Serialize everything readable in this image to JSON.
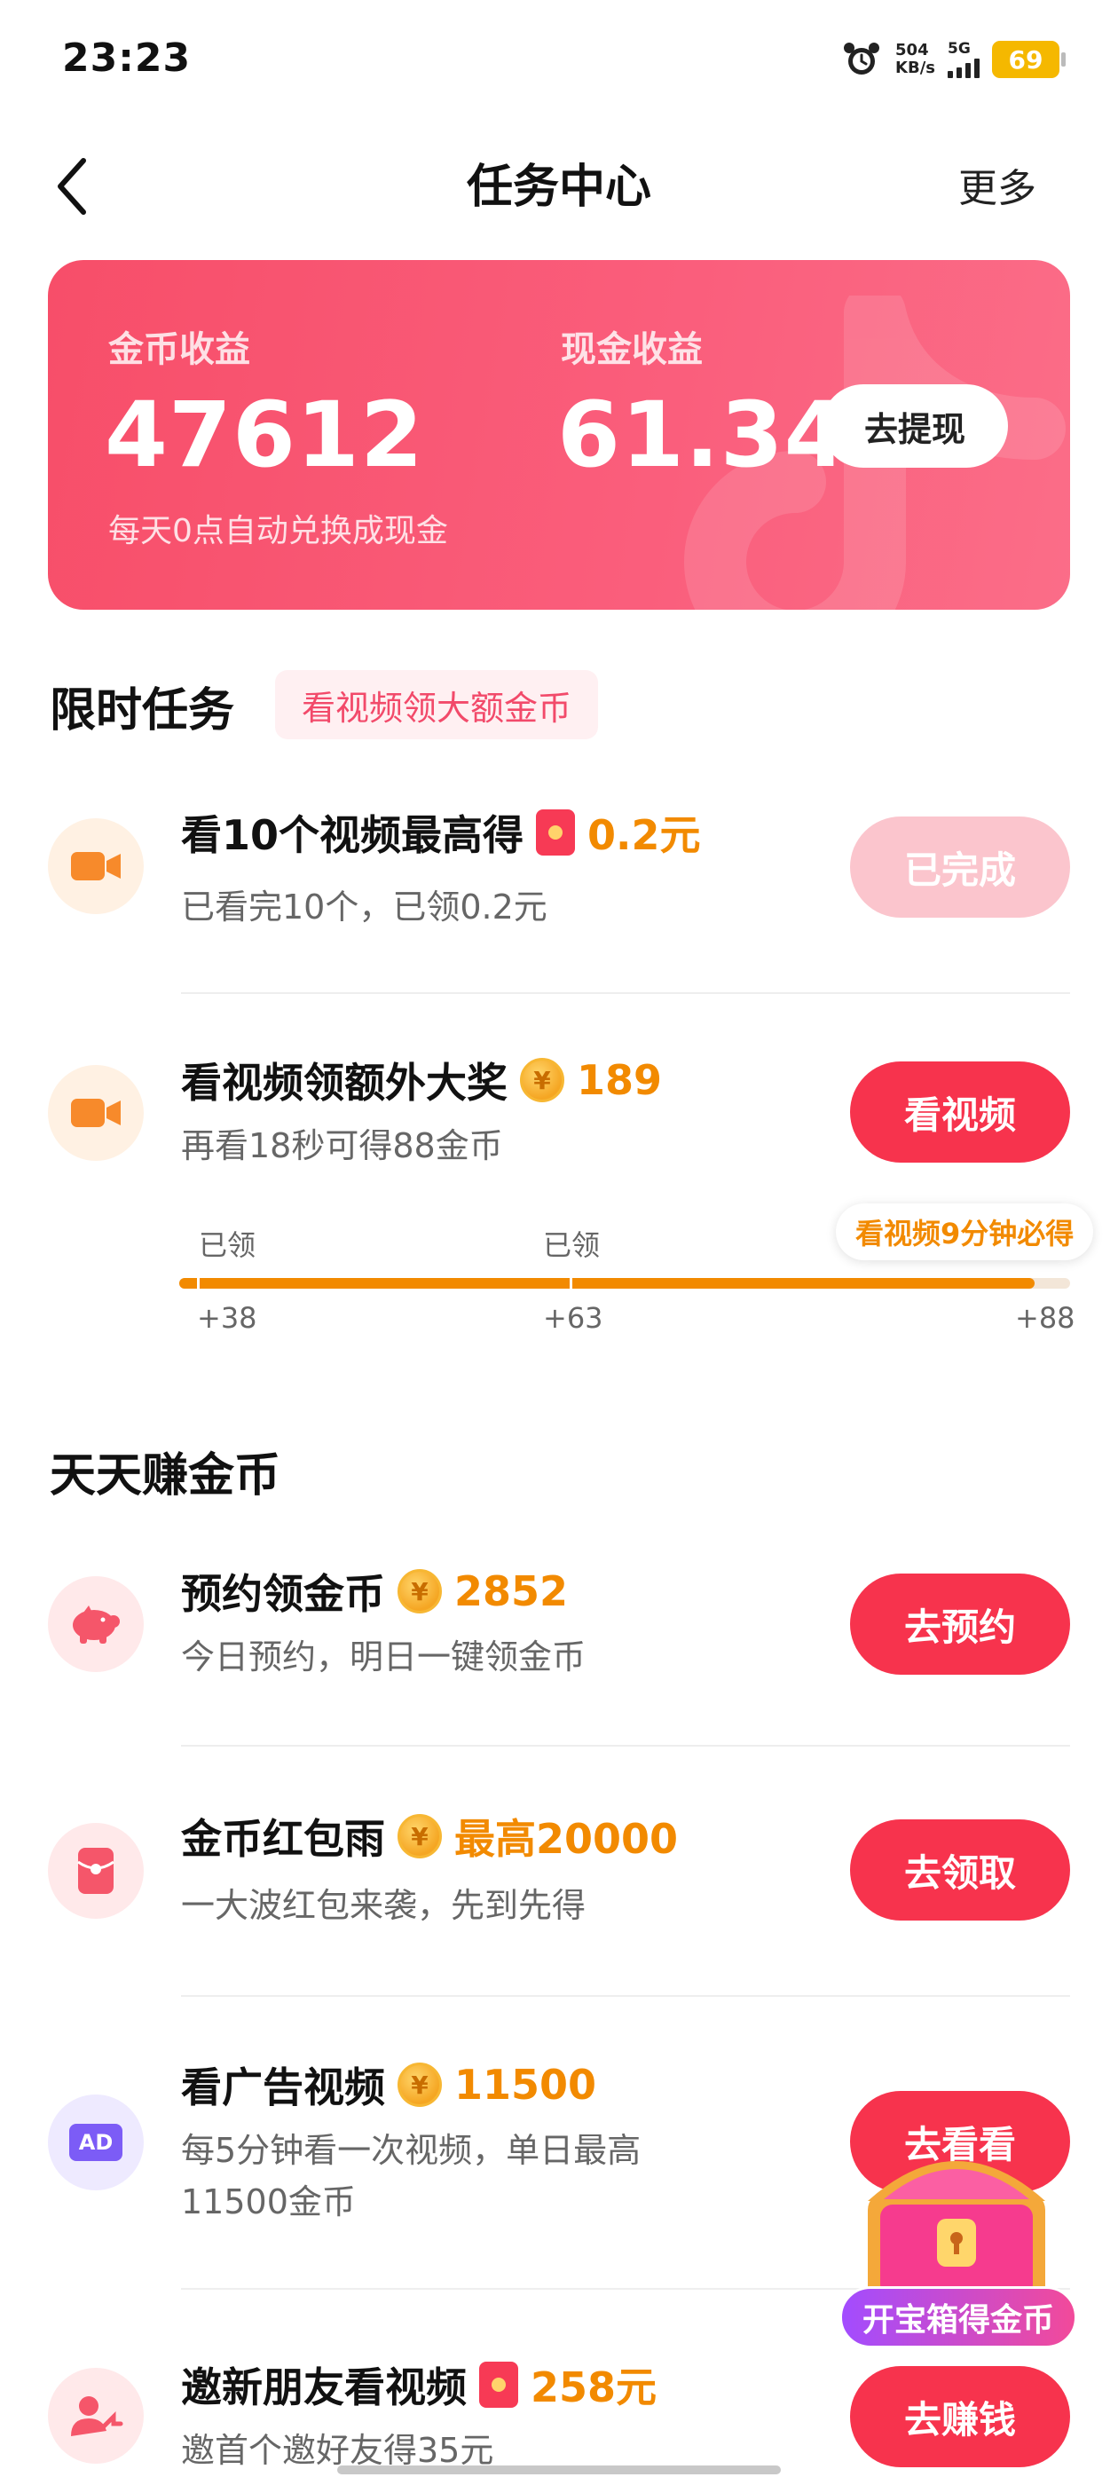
{
  "status_bar": {
    "time": "23:23",
    "net_speed_value": "504",
    "net_speed_unit": "KB/s",
    "network": "5G",
    "battery": "69"
  },
  "nav": {
    "title": "任务中心",
    "more": "更多"
  },
  "earnings": {
    "coin_label": "金币收益",
    "coin_value": "47612",
    "cash_label": "现金收益",
    "cash_value": "61.34",
    "withdraw_button": "去提现",
    "note": "每天0点自动兑换成现金"
  },
  "limited_section": {
    "title": "限时任务",
    "tag": "看视频领大额金币",
    "tasks": [
      {
        "title": "看10个视频最高得",
        "reward": "0.2元",
        "reward_icon": "red-envelope-icon",
        "desc": "已看完10个，已领0.2元",
        "button": "已完成",
        "icon": "video-camera-icon"
      },
      {
        "title": "看视频领额外大奖",
        "reward": "189",
        "reward_icon": "coin-icon",
        "desc": "再看18秒可得88金币",
        "button": "看视频",
        "icon": "video-camera-icon"
      }
    ],
    "progress": {
      "labels": [
        "已领",
        "已领"
      ],
      "values": [
        "+38",
        "+63",
        "+88"
      ],
      "tip": "看视频9分钟必得",
      "fill_fraction": 0.96
    }
  },
  "daily_section": {
    "title": "天天赚金币",
    "tasks": [
      {
        "title": "预约领金币",
        "reward": "2852",
        "reward_icon": "coin-icon",
        "desc": "今日预约，明日一键领金币",
        "button": "去预约",
        "icon": "piggy-bank-icon"
      },
      {
        "title": "金币红包雨",
        "reward": "最高20000",
        "reward_icon": "coin-icon",
        "desc": "一大波红包来袭，先到先得",
        "button": "去领取",
        "icon": "red-envelope-icon"
      },
      {
        "title": "看广告视频",
        "reward": "11500",
        "reward_icon": "coin-icon",
        "desc_line1": "每5分钟看一次视频，单日最高",
        "desc_line2": "11500金币",
        "button": "去看看",
        "icon": "ad-icon",
        "icon_text": "AD"
      },
      {
        "title": "邀新朋友看视频",
        "reward": "258元",
        "reward_icon": "red-envelope-icon",
        "desc": "邀首个邀好友得35元",
        "button": "去赚钱",
        "icon": "invite-friends-icon"
      }
    ]
  },
  "treasure": {
    "label": "开宝箱得金币"
  },
  "coin_glyph": "¥",
  "colors": {
    "accent": "#f7334d",
    "reward": "#f28a00",
    "card": "#f74e69"
  }
}
